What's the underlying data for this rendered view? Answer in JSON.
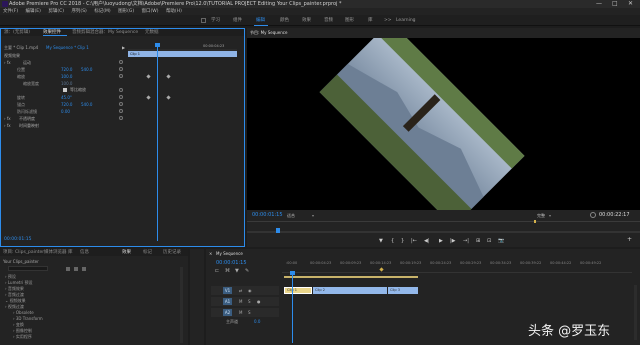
{
  "title_bar": {
    "title": "Adobe Premiere Pro CC 2018 - C:\\用户\\luoyudong\\文档\\Adobe\\Premiere Pro\\12.0\\TUTORIAL PROJECT Editing Your Clips_painter.prproj *"
  },
  "window_controls": [
    "—",
    "□",
    "✕"
  ],
  "menu": [
    "文件(F)",
    "编辑(E)",
    "剪辑(C)",
    "序列(S)",
    "标记(M)",
    "图形(G)",
    "窗口(W)",
    "帮助(H)"
  ],
  "workspaces": {
    "items": [
      "学习",
      "组件",
      "编辑",
      "颜色",
      "效果",
      "音频",
      "图形",
      "库",
      ">>",
      "Learning"
    ],
    "active_index": 2
  },
  "effect_controls": {
    "tabs": [
      "源：(无剪辑)",
      "效果控件",
      "音频剪辑混合器：My Sequence",
      "元数据"
    ],
    "active_tab": 1,
    "master": "主要 * Clip 1.mp4",
    "sequence": "My Sequence * Clip 1",
    "ruler_time": "00:00:04:23",
    "clip_bar": "Clip 1",
    "section_video": "视频效果",
    "fx_motion": "运动",
    "props": [
      {
        "label": "位置",
        "value": "720.0",
        "value2": "540.0"
      },
      {
        "label": "缩放",
        "value": "100.0"
      },
      {
        "label": "缩放宽度",
        "value": "100.0"
      },
      {
        "label": "",
        "value": "",
        "checkbox": "等比缩放"
      },
      {
        "label": "旋转",
        "value": "45.0°"
      },
      {
        "label": "锚点",
        "value": "720.0",
        "value2": "540.0"
      },
      {
        "label": "防闪烁滤镜",
        "value": "0.00"
      }
    ],
    "fx_opacity": "不透明度",
    "fx_time": "时间重映射",
    "timecode": "00:00:01:15"
  },
  "program": {
    "title": "节目: My Sequence",
    "timecode": "00:00:01:15",
    "fit": "适合",
    "quality": "完整",
    "duration": "00:00:22:17",
    "controls": [
      "▼",
      "{",
      "}",
      "|←",
      "◀|",
      "▶",
      "|▶",
      "→|",
      "⊞",
      "⊡",
      "📷",
      "+"
    ]
  },
  "project": {
    "tabs": [
      "项目: Clips_painter",
      "媒体浏览器",
      "库",
      "信息",
      "效果",
      "标记",
      "历史记录"
    ],
    "active_tab": 4,
    "title": "Your Clips_painter",
    "items": [
      "预设",
      "Lumetri 预设",
      "音频效果",
      "音频过渡",
      "视频效果",
      "视频过渡",
      "Obsolete",
      "3D Transform",
      "变换",
      "图像控制",
      "实用程序"
    ]
  },
  "timeline": {
    "tab": "My Sequence",
    "timecode": "00:00:01:15",
    "ruler": [
      ":00:00",
      "00:00:04:23",
      "00:00:09:23",
      "00:00:14:23",
      "00:00:19:23",
      "00:00:24:23",
      "00:00:29:23",
      "00:00:34:23",
      "00:00:39:22",
      "00:00:44:22",
      "00:00:49:22"
    ],
    "tracks": [
      "V1",
      "A1",
      "A2"
    ],
    "clips": [
      {
        "label": "Clip 1"
      },
      {
        "label": "Clip 2"
      },
      {
        "label": "Clip 3"
      }
    ],
    "master_label": "主声道",
    "master_value": "0.0"
  },
  "watermark": "头条 @罗玉东",
  "colors": {
    "accent": "#2d8ceb",
    "clip_fill": "#93b8ea",
    "clip_active": "#e9d58a"
  }
}
